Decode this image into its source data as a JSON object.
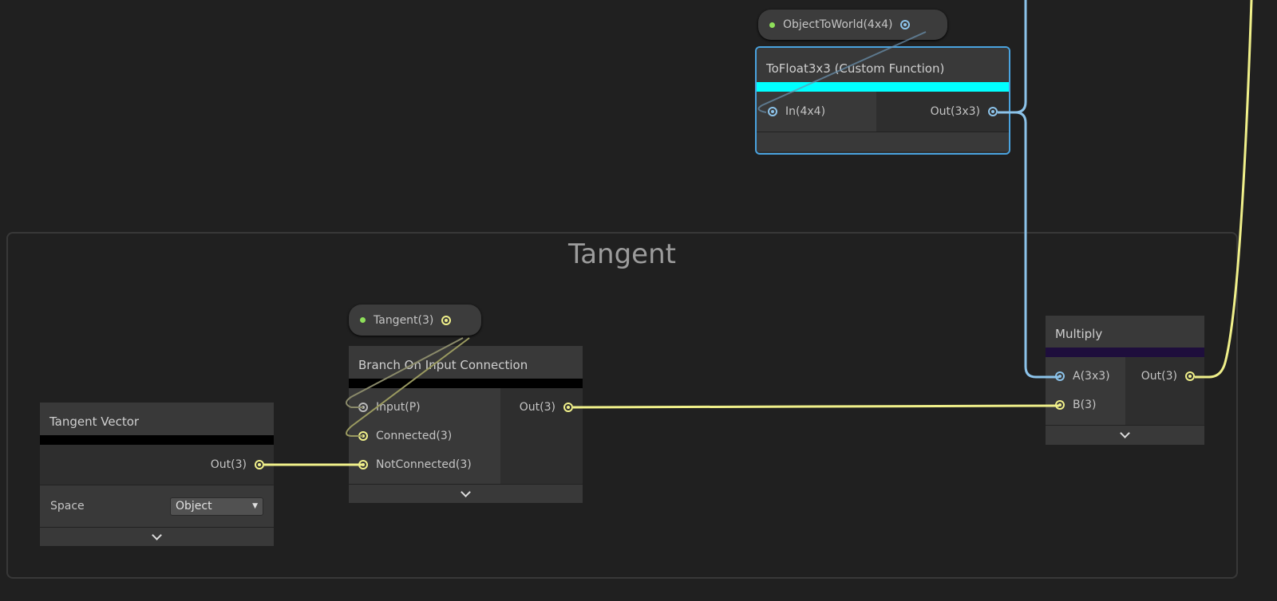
{
  "group": {
    "title": "Tangent"
  },
  "properties": {
    "object_to_world": {
      "label": "ObjectToWorld(4x4)"
    },
    "tangent": {
      "label": "Tangent(3)"
    }
  },
  "nodes": {
    "to_float": {
      "title": "ToFloat3x3 (Custom Function)",
      "input": "In(4x4)",
      "output": "Out(3x3)",
      "accent": "#00ffff"
    },
    "branch": {
      "title": "Branch On Input Connection",
      "inputs": [
        "Input(P)",
        "Connected(3)",
        "NotConnected(3)"
      ],
      "output": "Out(3)",
      "accent": "#000000"
    },
    "tangent_vector": {
      "title": "Tangent Vector",
      "output": "Out(3)",
      "space_label": "Space",
      "space_value": "Object",
      "accent": "#000000"
    },
    "multiply": {
      "title": "Multiply",
      "inputs": [
        "A(3x3)",
        "B(3)"
      ],
      "output": "Out(3)",
      "accent": "#1e0e3c"
    }
  },
  "colors": {
    "matrix_wire": "#8cc3ea",
    "vector_wire": "#f0f08a",
    "selection": "#4aa3df"
  }
}
